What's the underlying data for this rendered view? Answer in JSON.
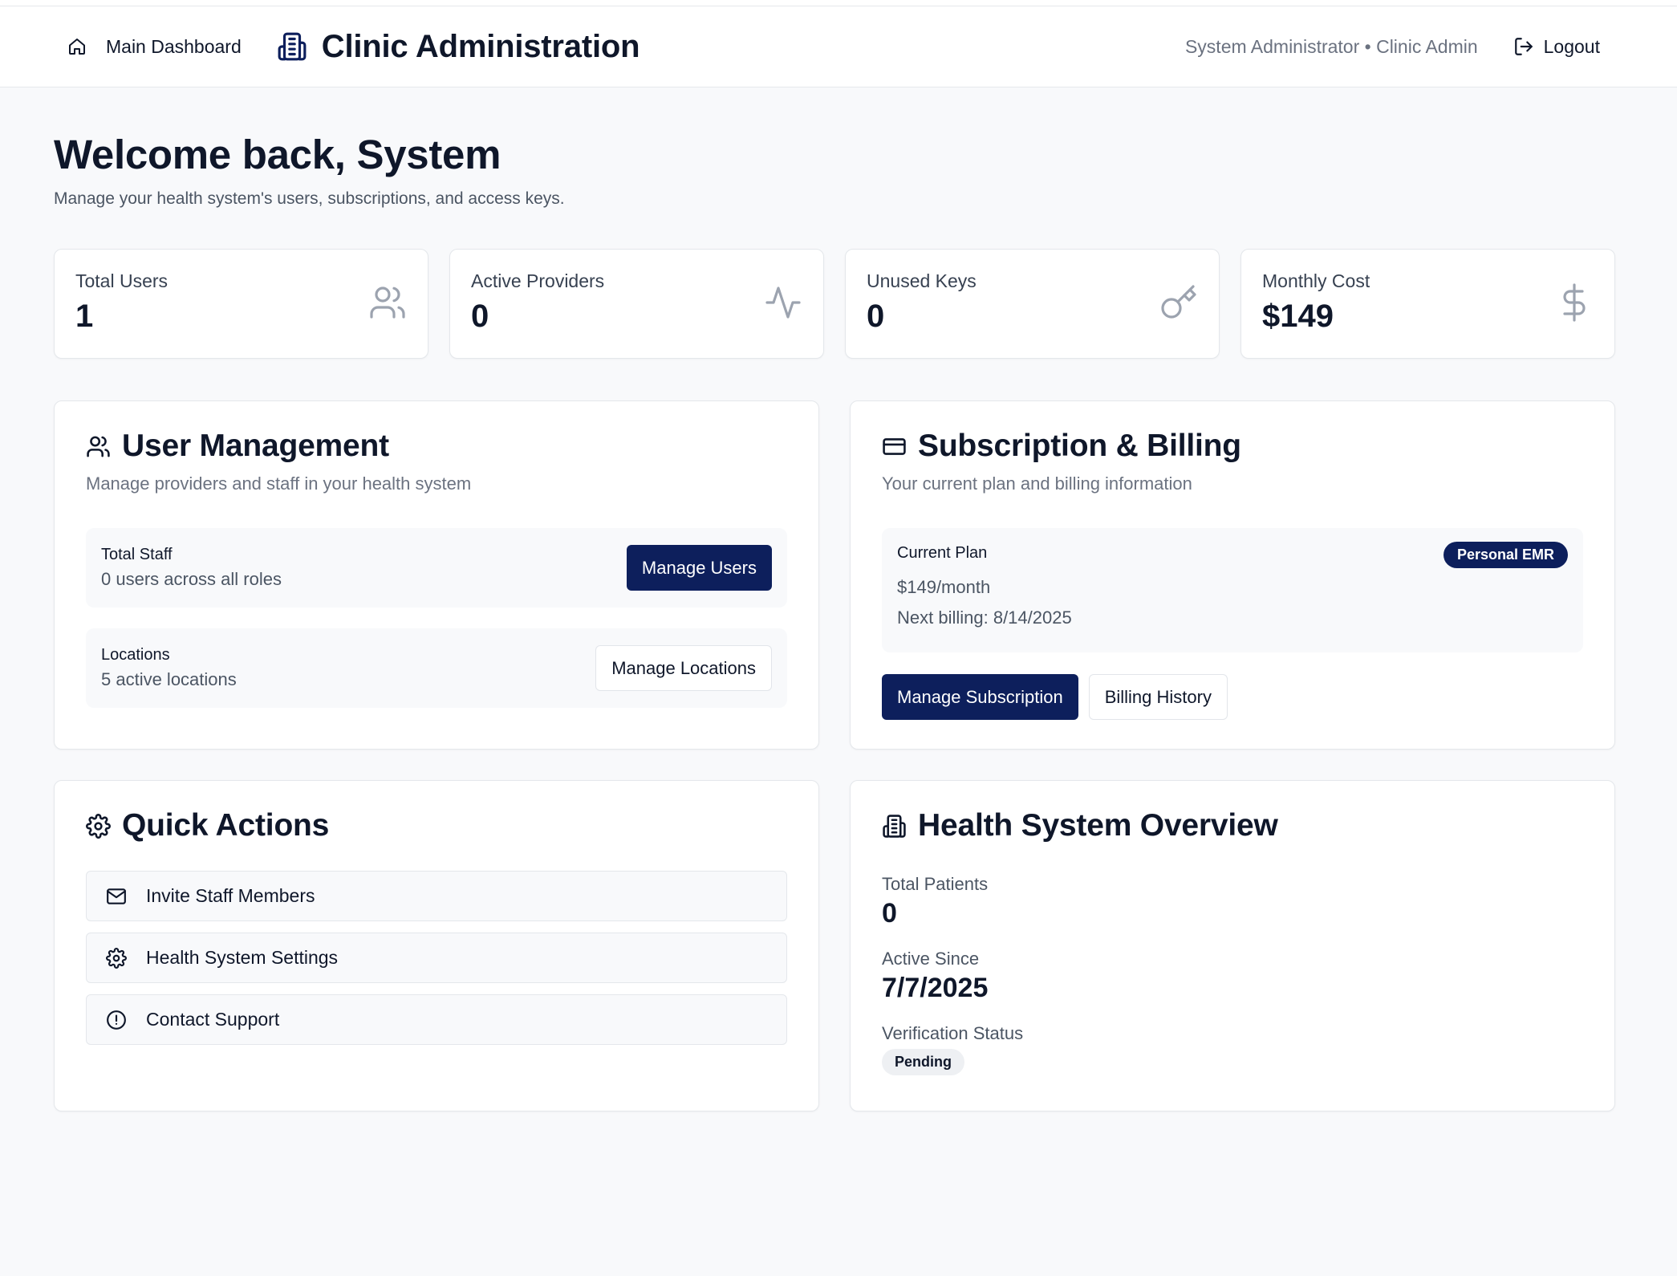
{
  "header": {
    "home_label": "Main Dashboard",
    "app_title": "Clinic Administration",
    "user_info": "System Administrator • Clinic Admin",
    "logout_label": "Logout"
  },
  "page": {
    "welcome": "Welcome back, System",
    "subtitle": "Manage your health system's users, subscriptions, and access keys."
  },
  "stats": [
    {
      "label": "Total Users",
      "value": "1",
      "icon": "users-icon"
    },
    {
      "label": "Active Providers",
      "value": "0",
      "icon": "activity-icon"
    },
    {
      "label": "Unused Keys",
      "value": "0",
      "icon": "key-icon"
    },
    {
      "label": "Monthly Cost",
      "value": "$149",
      "icon": "dollar-icon"
    }
  ],
  "user_management": {
    "title": "User Management",
    "description": "Manage providers and staff in your health system",
    "staff": {
      "title": "Total Staff",
      "subtitle": "0 users across all roles",
      "button": "Manage Users"
    },
    "locations": {
      "title": "Locations",
      "subtitle": "5 active locations",
      "button": "Manage Locations"
    }
  },
  "subscription": {
    "title": "Subscription & Billing",
    "description": "Your current plan and billing information",
    "plan_label": "Current Plan",
    "plan_badge": "Personal EMR",
    "price": "$149/month",
    "next_billing": "Next billing: 8/14/2025",
    "manage_button": "Manage Subscription",
    "history_button": "Billing History"
  },
  "quick_actions": {
    "title": "Quick Actions",
    "items": [
      {
        "label": "Invite Staff Members",
        "icon": "mail-icon"
      },
      {
        "label": "Health System Settings",
        "icon": "gear-icon"
      },
      {
        "label": "Contact Support",
        "icon": "alert-circle-icon"
      }
    ]
  },
  "overview": {
    "title": "Health System Overview",
    "total_patients_label": "Total Patients",
    "total_patients": "0",
    "active_since_label": "Active Since",
    "active_since": "7/7/2025",
    "verification_label": "Verification Status",
    "verification_status": "Pending"
  },
  "colors": {
    "primary": "#0d1f5c",
    "text": "#0f172a",
    "muted": "#6b7280",
    "icon_gray": "#9ca3af"
  }
}
